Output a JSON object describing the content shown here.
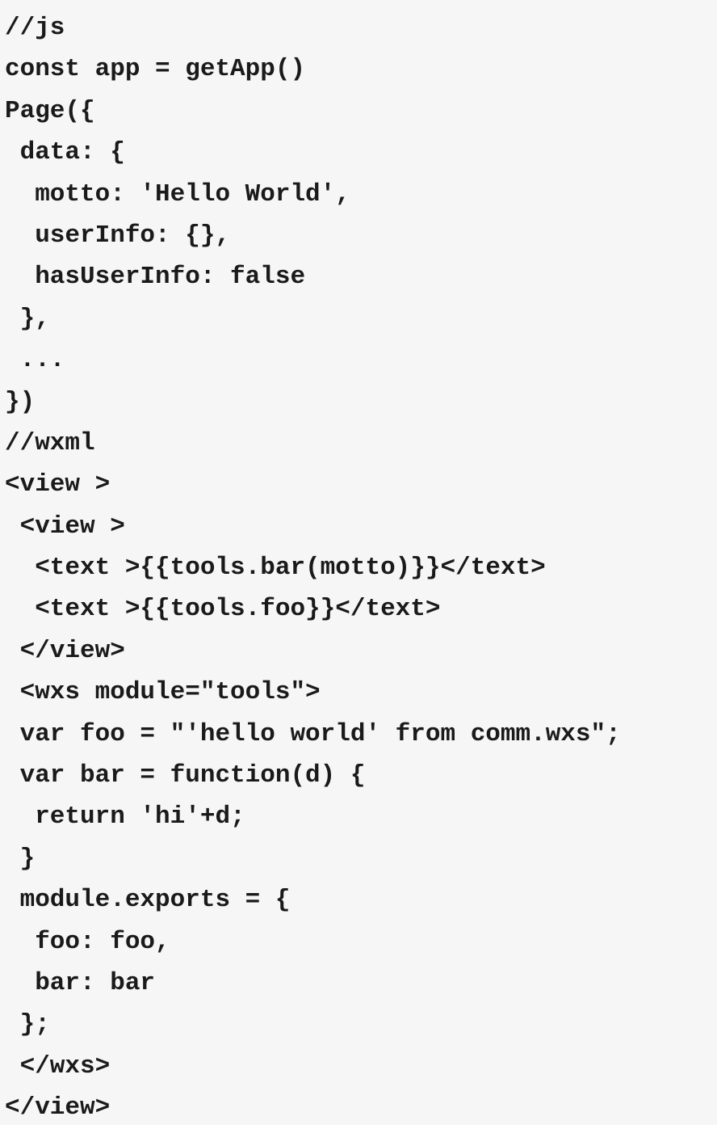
{
  "code": {
    "lines": [
      "//js",
      "const app = getApp()",
      "Page({",
      " data: {",
      "  motto: 'Hello World',",
      "  userInfo: {},",
      "  hasUserInfo: false",
      " },",
      " ...",
      "})",
      "//wxml",
      "<view >",
      " <view >",
      "  <text >{{tools.bar(motto)}}</text>",
      "  <text >{{tools.foo}}</text>",
      " </view>",
      " <wxs module=\"tools\">",
      " var foo = \"'hello world' from comm.wxs\";",
      " var bar = function(d) {",
      "  return 'hi'+d;",
      " }",
      " module.exports = {",
      "  foo: foo,",
      "  bar: bar",
      " };",
      " </wxs>",
      "</view>"
    ]
  }
}
